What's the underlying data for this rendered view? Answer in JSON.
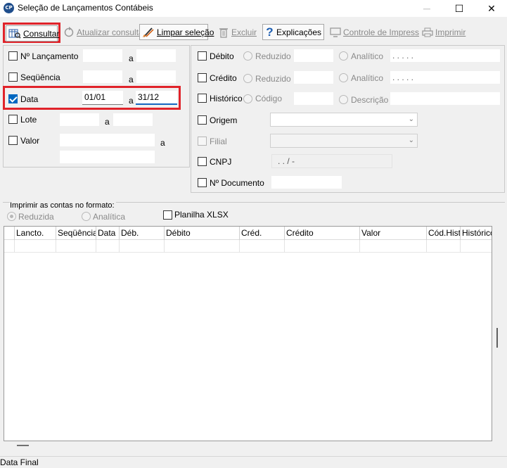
{
  "window": {
    "title": "Seleção de Lançamentos Contábeis",
    "app_icon_text": "CP",
    "minimize": "─",
    "maximize": "☐",
    "close": "✕"
  },
  "toolbar": {
    "consultar": "Consultar",
    "atualizar": "Atualizar consulta",
    "limpar": "Limpar seleção",
    "excluir": "Excluir",
    "explicacoes": "Explicações",
    "controle": "Controle de Impressão",
    "imprimir": "Imprimir"
  },
  "left": {
    "lancamento": {
      "label": "Nº Lançamento",
      "from": "",
      "to": "",
      "sep": "a",
      "checked": false
    },
    "sequencia": {
      "label": "Seqüência",
      "from": "",
      "to": "",
      "sep": "a",
      "checked": false
    },
    "data": {
      "label": "Data",
      "from": "01/01",
      "to": "31/12",
      "sep": "a",
      "checked": true
    },
    "lote": {
      "label": "Lote",
      "from": "",
      "to": "",
      "sep": "a",
      "checked": false
    },
    "valor": {
      "label": "Valor",
      "from": "",
      "to": "",
      "sep": "a",
      "checked": false
    }
  },
  "right": {
    "debito": {
      "label": "Débito",
      "reduzido": "Reduzido",
      "analitico": "Analítico",
      "mask": ". . . . ."
    },
    "credito": {
      "label": "Crédito",
      "reduzido": "Reduzido",
      "analitico": "Analítico",
      "mask": ". . . . ."
    },
    "historico": {
      "label": "Histórico",
      "codigo": "Código",
      "descricao": "Descrição"
    },
    "origem": {
      "label": "Origem",
      "value": ""
    },
    "filial": {
      "label": "Filial",
      "value": ""
    },
    "cnpj": {
      "label": "CNPJ",
      "mask": ".   .   /   -"
    },
    "documento": {
      "label": "Nº Documento",
      "value": ""
    }
  },
  "print_format": {
    "legend": "Imprimir as contas no formato:",
    "reduzida": "Reduzida",
    "analitica": "Analítica",
    "planilha": "Planilha XLSX"
  },
  "grid": {
    "columns": [
      "Lancto.",
      "Seqüência",
      "Data",
      "Déb.",
      "Débito",
      "Créd.",
      "Crédito",
      "Valor",
      "Cód.Hist.",
      "Histórico"
    ]
  },
  "status_bar": {
    "text": "Data Final"
  },
  "colors": {
    "highlight": "#e0232a",
    "checkbox_checked": "#0067c0",
    "active_underline": "#1565c0"
  }
}
